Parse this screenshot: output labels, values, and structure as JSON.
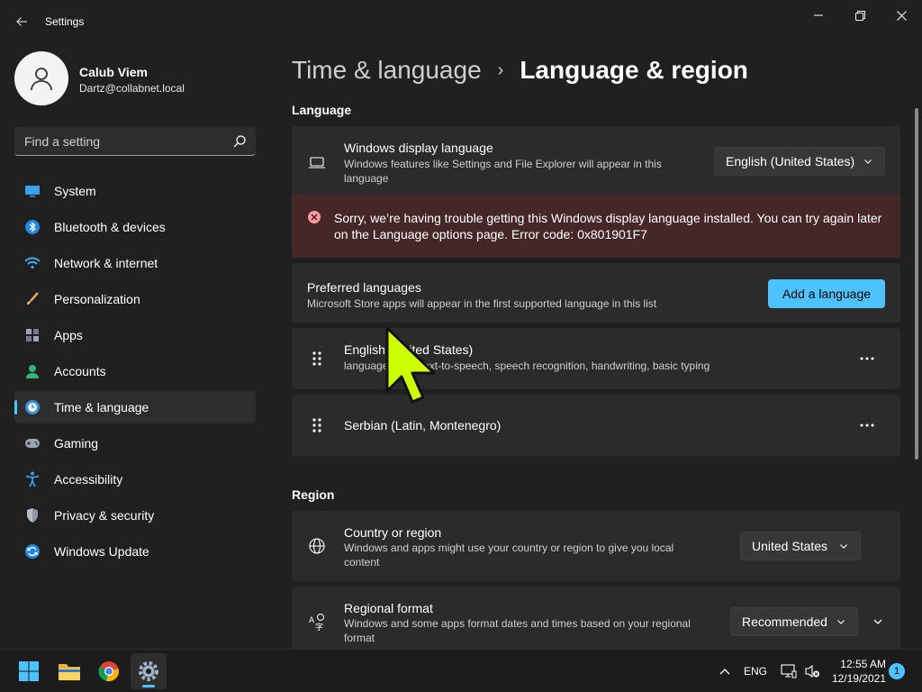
{
  "window": {
    "title": "Settings"
  },
  "profile": {
    "name": "Calub Viem",
    "email": "Dartz@collabnet.local"
  },
  "search": {
    "placeholder": "Find a setting"
  },
  "sidebar": {
    "items": [
      {
        "label": "System",
        "icon": "system-icon"
      },
      {
        "label": "Bluetooth & devices",
        "icon": "bluetooth-icon"
      },
      {
        "label": "Network & internet",
        "icon": "wifi-icon"
      },
      {
        "label": "Personalization",
        "icon": "brush-icon"
      },
      {
        "label": "Apps",
        "icon": "apps-icon"
      },
      {
        "label": "Accounts",
        "icon": "accounts-icon"
      },
      {
        "label": "Time & language",
        "icon": "time-language-icon",
        "active": true
      },
      {
        "label": "Gaming",
        "icon": "gamepad-icon"
      },
      {
        "label": "Accessibility",
        "icon": "accessibility-icon"
      },
      {
        "label": "Privacy & security",
        "icon": "shield-icon"
      },
      {
        "label": "Windows Update",
        "icon": "windows-update-icon"
      }
    ]
  },
  "breadcrumb": {
    "parent": "Time & language",
    "separator": "›",
    "current": "Language & region"
  },
  "language_section": {
    "title": "Language",
    "display_language": {
      "title": "Windows display language",
      "description": "Windows features like Settings and File Explorer will appear in this language",
      "selected": "English (United States)"
    },
    "error": {
      "message": "Sorry, we’re having trouble getting this Windows display language installed. You can try again later on the Language options page. Error code: 0x801901F7"
    },
    "preferred": {
      "title": "Preferred languages",
      "description": "Microsoft Store apps will appear in the first supported language in this list",
      "button": "Add a language"
    },
    "languages": [
      {
        "name": "English (United States)",
        "features": "language pack, text-to-speech, speech recognition, handwriting, basic typing"
      },
      {
        "name": "Serbian (Latin, Montenegro)",
        "features": ""
      }
    ]
  },
  "region_section": {
    "title": "Region",
    "country": {
      "title": "Country or region",
      "description": "Windows and apps might use your country or region to give you local content",
      "selected": "United States"
    },
    "format": {
      "title": "Regional format",
      "description": "Windows and some apps format dates and times based on your regional format",
      "selected": "Recommended"
    }
  },
  "taskbar": {
    "apps": [
      "start-icon",
      "file-explorer-icon",
      "chrome-icon",
      "settings-icon"
    ],
    "input_language": "ENG",
    "time": "12:55 AM",
    "date": "12/19/2021",
    "notification_count": "1"
  },
  "colors": {
    "accent": "#4cc2ff",
    "background": "#202020",
    "card": "#2b2b2b",
    "error_background": "#442726",
    "error_icon": "#ff99a4",
    "cursor": "#ccff00"
  }
}
